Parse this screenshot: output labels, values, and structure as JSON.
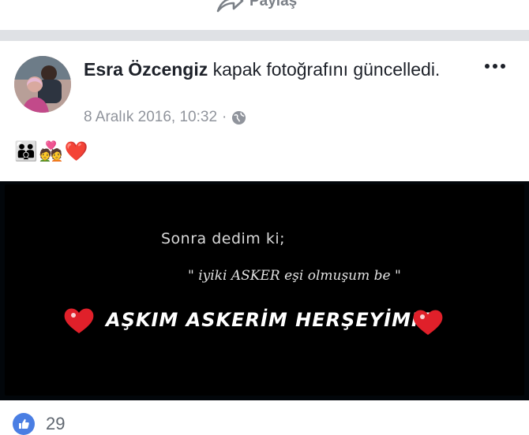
{
  "top_bar": {
    "share_label": "Paylaş",
    "share_icon": "share-arrow-icon"
  },
  "post": {
    "author": "Esra Özcengiz",
    "action": "kapak fotoğrafını güncelledi.",
    "timestamp": "8 Aralık 2016, 10:32",
    "separator": "·",
    "privacy_icon": "globe-icon",
    "more_icon": "more-options-icon",
    "emojis": [
      "👪",
      "💑",
      "❤️"
    ],
    "cover_text": {
      "line1": "Sonra dedim ki;",
      "line2": "\" iyiki ASKER eşi olmuşum be \"",
      "line3": "AŞKIM ASKERİM HERŞEYİMM"
    },
    "reactions": {
      "icon": "like-icon",
      "count": "29"
    }
  },
  "colors": {
    "accent": "#4a7ee3",
    "text": "#1d2129",
    "meta": "#90949c",
    "divider": "#dfe1e5",
    "heart": "#e0202a"
  }
}
